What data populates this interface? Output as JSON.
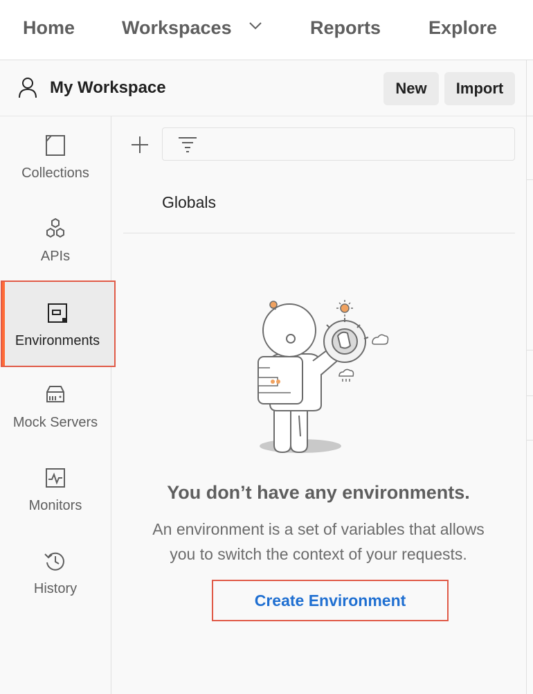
{
  "nav": {
    "home": "Home",
    "workspaces": "Workspaces",
    "reports": "Reports",
    "explore": "Explore"
  },
  "workspace": {
    "title": "My Workspace",
    "new_label": "New",
    "import_label": "Import"
  },
  "sidebar": {
    "items": [
      {
        "label": "Collections",
        "icon": "collections-icon"
      },
      {
        "label": "APIs",
        "icon": "apis-icon"
      },
      {
        "label": "Environments",
        "icon": "environments-icon",
        "active": true
      },
      {
        "label": "Mock Servers",
        "icon": "mock-servers-icon"
      },
      {
        "label": "Monitors",
        "icon": "monitors-icon"
      },
      {
        "label": "History",
        "icon": "history-icon"
      }
    ]
  },
  "main": {
    "globals": "Globals",
    "empty_title": "You don’t have any environments.",
    "empty_desc_line1": "An environment is a set of variables that allows",
    "empty_desc_line2": "you to switch the context of your requests.",
    "create_button": "Create Environment"
  },
  "colors": {
    "accent": "#ff6c37",
    "highlight_border": "#e05a47",
    "link_blue": "#1f6fd1"
  }
}
